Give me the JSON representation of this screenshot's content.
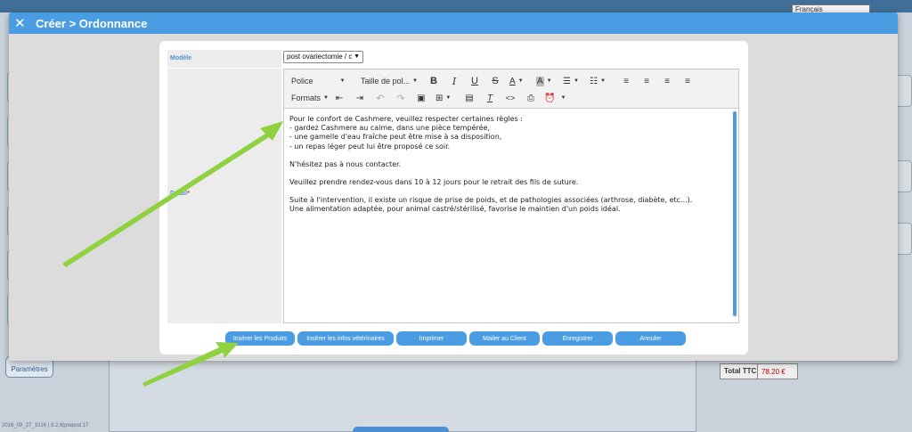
{
  "background": {
    "language": "Français",
    "params_label": "Paramètres",
    "version": "2016_09_27_1016 | 8.2.8(prepod 17",
    "total_label": "Total TTC",
    "total_value": "78.20 €"
  },
  "modal": {
    "title": "Créer > Ordonnance",
    "fields": {
      "modele_label": "Modèle",
      "modele_value": "post ovariectomie / c",
      "detail_label": "Détail",
      "required_mark": "*"
    },
    "toolbar": {
      "font": "Police",
      "size": "Taille de pol...",
      "formats": "Formats"
    },
    "content": {
      "p1": [
        "Pour le confort de Cashmere, veuillez respecter certaines règles :",
        "- gardez Cashmere au calme, dans une pièce tempérée,",
        "- une gamelle d'eau fraîche peut être mise à sa disposition,",
        "- un repas léger peut lui être proposé ce soir."
      ],
      "p2": "N'hésitez pas à nous contacter.",
      "p3": "Veuillez prendre rendez-vous dans 10 à 12 jours pour le retrait des fils de suture.",
      "p4": [
        "Suite à l'intervention, il existe un risque de prise de poids, et de pathologies associées (arthrose, diabète, etc...).",
        "Une alimentation adaptée, pour animal castré/stérilisé, favorise le maintien d'un poids idéal."
      ]
    },
    "buttons": {
      "insert_products": "Insérer les Produits",
      "insert_vet": "Insérer les infos vétérinaires",
      "print": "Imprimer",
      "mail": "Mailer au Client",
      "save": "Enregistrer",
      "cancel": "Annuler"
    }
  },
  "colors": {
    "accent": "#4a9de3",
    "arrow": "#8fd13f"
  }
}
